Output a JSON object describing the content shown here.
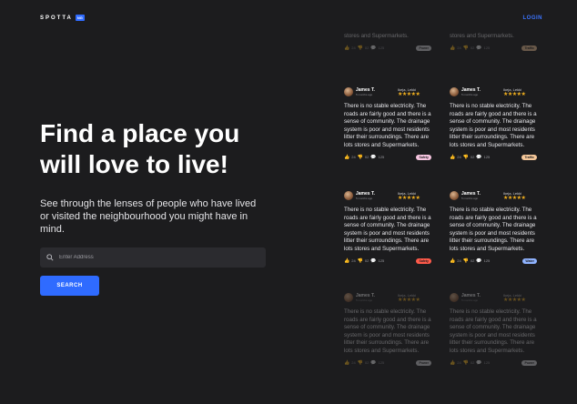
{
  "header": {
    "brand": "SPOTTA",
    "brand_badge": "NG",
    "login_label": "LOGIN"
  },
  "hero": {
    "title_line1": "Find a place you",
    "title_line2": "will love to live!",
    "subtitle": "See through the lenses of people who have lived or visited the neighbourhood you might have in mind."
  },
  "search": {
    "placeholder": "Enter Address",
    "button_label": "SEARCH"
  },
  "review": {
    "name": "James T.",
    "sub": "5 months ago",
    "location": "Ikeja, Lekki",
    "stars": "★★★★★",
    "text": "There is no stable electricity. The roads are fairly good and there is a sense of community. The drainage system is poor and most residents litter their surroundings. There are lots stores and Supermarkets.",
    "text_short": "stores and Supermarkets."
  },
  "cards": [
    {
      "likes": "24",
      "dislikes": "02",
      "comments": "125",
      "tag": "Safety",
      "tag_color": "#f7c6e1"
    },
    {
      "likes": "24",
      "dislikes": "02",
      "comments": "125",
      "tag": "Traffic",
      "tag_color": "#f6c89a"
    },
    {
      "likes": "24",
      "dislikes": "02",
      "comments": "125",
      "tag": "Safety",
      "tag_color": "#ff5a4a"
    },
    {
      "likes": "24",
      "dislikes": "02",
      "comments": "125",
      "tag": "Water",
      "tag_color": "#8fb3ff"
    },
    {
      "likes": "24",
      "dislikes": "02",
      "comments": "125",
      "tag": "Power",
      "tag_color": "#dadade"
    },
    {
      "likes": "24",
      "dislikes": "02",
      "comments": "125",
      "tag": "Power",
      "tag_color": "#dadade"
    },
    {
      "likes": "24",
      "dislikes": "02",
      "comments": "125",
      "tag": "Power",
      "tag_color": "#dadade"
    },
    {
      "likes": "24",
      "dislikes": "02",
      "comments": "125",
      "tag": "Power",
      "tag_color": "#dadade"
    }
  ]
}
